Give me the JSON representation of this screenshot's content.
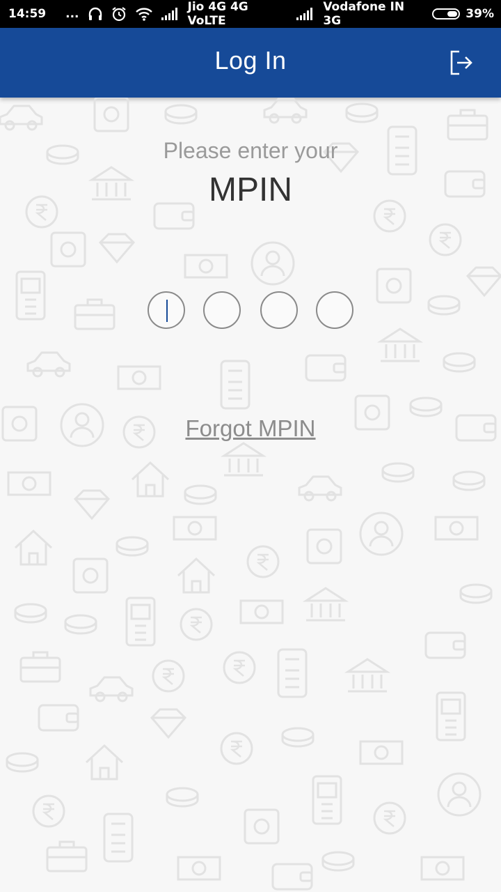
{
  "status_bar": {
    "time": "14:59",
    "dots": "...",
    "carrier1": "Jio 4G 4G VoLTE",
    "carrier2": "Vodafone IN 3G",
    "battery": "39%"
  },
  "app_bar": {
    "title": "Log In",
    "logout_icon": "logout-icon",
    "color": "#164a98"
  },
  "login": {
    "prompt": "Please enter your",
    "title": "MPIN",
    "pin_length": 4,
    "forgot_label": "Forgot MPIN"
  },
  "background": {
    "pattern": "finance-doodle-icons"
  }
}
